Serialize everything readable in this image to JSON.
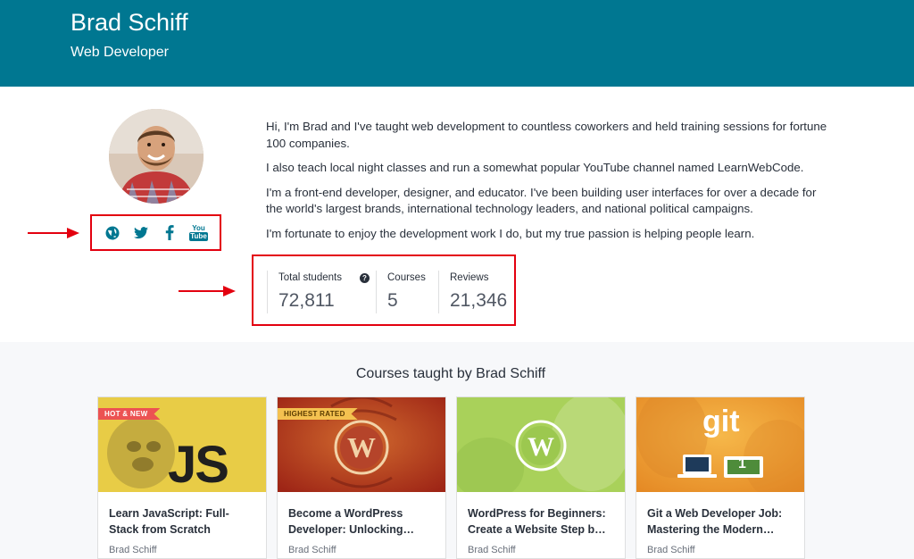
{
  "header": {
    "name": "Brad Schiff",
    "role": "Web Developer"
  },
  "profile": {
    "social": [
      "globe-icon",
      "twitter-icon",
      "facebook-icon",
      "youtube-icon"
    ],
    "youtube_text_top": "You",
    "youtube_text_bottom": "Tube"
  },
  "bio": [
    "Hi, I'm Brad and I've taught web development to countless coworkers and held training sessions for fortune 100 companies.",
    "I also teach local night classes and run a somewhat popular YouTube channel named LearnWebCode.",
    "I'm a front-end developer, designer, and educator. I've been building user interfaces for over a decade for the world's largest brands, international technology leaders, and national political campaigns.",
    "I'm fortunate to enjoy the development work I do, but my true passion is helping people learn."
  ],
  "stats": [
    {
      "label": "Total students",
      "value": "72,811",
      "help": "?"
    },
    {
      "label": "Courses",
      "value": "5"
    },
    {
      "label": "Reviews",
      "value": "21,346"
    }
  ],
  "courses": {
    "heading": "Courses taught by Brad Schiff",
    "items": [
      {
        "badge": "HOT & NEW",
        "thumb_text": "JS",
        "title": "Learn JavaScript: Full-Stack from Scratch",
        "author": "Brad Schiff"
      },
      {
        "badge": "HIGHEST RATED",
        "title": "Become a WordPress Developer: Unlocking…",
        "author": "Brad Schiff"
      },
      {
        "title": "WordPress for Beginners: Create a Website Step b…",
        "author": "Brad Schiff"
      },
      {
        "thumb_text": "git",
        "thumb_text_2": "1",
        "title": "Git a Web Developer Job: Mastering the Modern…",
        "author": "Brad Schiff"
      }
    ]
  },
  "colors": {
    "header": "#007791",
    "annotation": "#e3000f",
    "band": "#f7f8fa"
  }
}
